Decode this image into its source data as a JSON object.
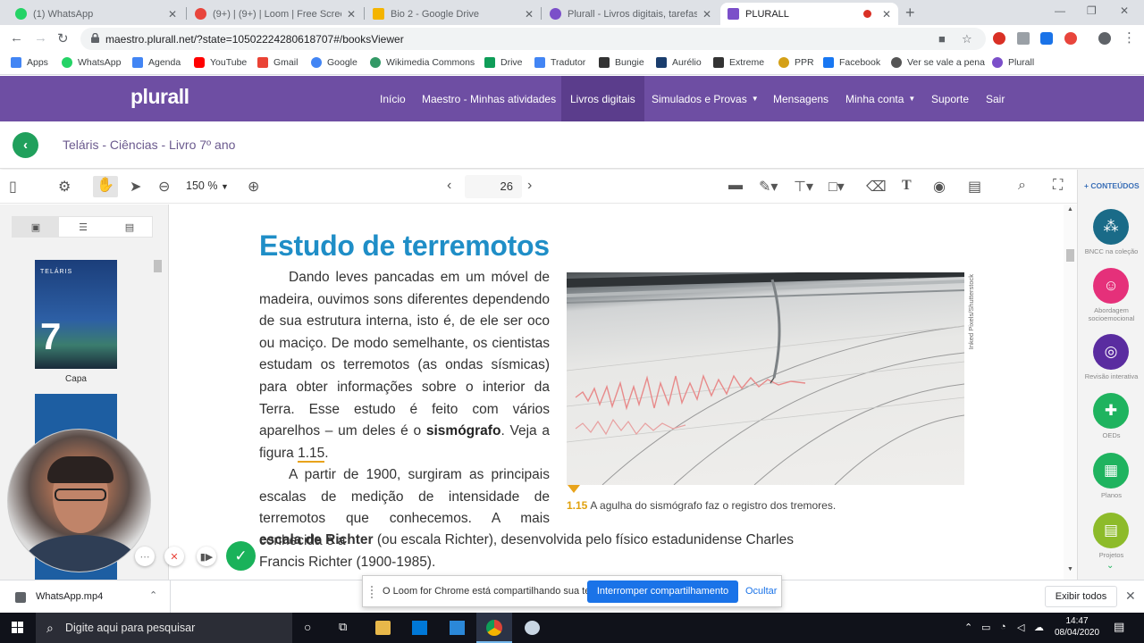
{
  "browser": {
    "tabs": [
      {
        "title": "(1) WhatsApp",
        "icon_color": "#25d366",
        "active": false
      },
      {
        "title": "(9+) | (9+) | Loom | Free Screen &",
        "icon_color": "#e8453c",
        "active": false
      },
      {
        "title": "Bio 2 - Google Drive",
        "icon_color": "#f4b400",
        "active": false
      },
      {
        "title": "Plurall - Livros digitais, tarefas, tu",
        "icon_color": "#7b4fc9",
        "active": false
      },
      {
        "title": "PLURALL",
        "icon_color": "#7b4fc9",
        "active": true
      }
    ],
    "url": "maestro.plurall.net/?state=10502224280618707#/booksViewer",
    "bookmarks": [
      {
        "label": "Apps",
        "icon_color": "#4285f4"
      },
      {
        "label": "WhatsApp",
        "icon_color": "#25d366"
      },
      {
        "label": "Agenda",
        "icon_color": "#4285f4"
      },
      {
        "label": "YouTube",
        "icon_color": "#ff0000"
      },
      {
        "label": "Gmail",
        "icon_color": "#ea4335"
      },
      {
        "label": "Google",
        "icon_color": "#4285f4"
      },
      {
        "label": "Wikimedia Commons",
        "icon_color": "#339966"
      },
      {
        "label": "Drive",
        "icon_color": "#0f9d58"
      },
      {
        "label": "Tradutor",
        "icon_color": "#4285f4"
      },
      {
        "label": "Bungie",
        "icon_color": "#333333"
      },
      {
        "label": "Aurélio",
        "icon_color": "#1a3d6d"
      },
      {
        "label": "Extreme",
        "icon_color": "#333333"
      },
      {
        "label": "PPR",
        "icon_color": "#d4a017"
      },
      {
        "label": "Facebook",
        "icon_color": "#1877f2"
      },
      {
        "label": "Ver se vale a pena",
        "icon_color": "#555555"
      },
      {
        "label": "Plurall",
        "icon_color": "#7b4fc9"
      }
    ]
  },
  "plurall": {
    "logo": "plurall",
    "nav": [
      {
        "label": "Início",
        "active": false
      },
      {
        "label": "Maestro - Minhas atividades",
        "active": false
      },
      {
        "label": "Livros digitais",
        "active": true
      },
      {
        "label": "Simulados e Provas",
        "active": false,
        "dropdown": true
      },
      {
        "label": "Mensagens",
        "active": false
      },
      {
        "label": "Minha conta",
        "active": false,
        "dropdown": true
      },
      {
        "label": "Suporte",
        "active": false
      },
      {
        "label": "Sair",
        "active": false
      }
    ],
    "book_title": "Teláris - Ciências - Livro 7º ano",
    "brand_color": "#6e4ea3"
  },
  "viewer": {
    "zoom": "150 %",
    "page": "26",
    "thumb_label": "Capa",
    "cover_number": "7",
    "cover_brand": "TELÁRIS",
    "sidebar_title": "+ CONTEÚDOS",
    "sidebar_items": [
      {
        "label": "BNCC na coleção",
        "color": "#1a6b88"
      },
      {
        "label": "Abordagem socioemocional",
        "color": "#e5307a"
      },
      {
        "label": "Revisão interativa",
        "color": "#5a2ca0"
      },
      {
        "label": "OEDs",
        "color": "#1fb35f"
      },
      {
        "label": "Planos",
        "color": "#1fb35f"
      },
      {
        "label": "Projetos",
        "color": "#8dbb2a"
      }
    ]
  },
  "content": {
    "heading": "Estudo de terremotos",
    "para1_indent": "Dando leves pancadas em um móvel de madeira, ouvimos sons diferentes dependendo de sua estrutura interna, isto é, de ele ser oco ou maciço. De modo semelhante, os cientistas estudam os terremotos (as ondas sísmicas) para obter informações sobre o interior da Terra. Esse estudo é feito com vários aparelhos – um deles é o ",
    "para1_bold": "sismógrafo",
    "para1_tail": ". Veja a figura ",
    "para1_ref": "1.15",
    "para1_end": ".",
    "para2": "A partir de 1900, surgiram as principais escalas de medição de intensidade de terremotos que conhecemos. A mais conhecida é a",
    "para3_bold": "escala de Richter",
    "para3_rest": " (ou escala Richter), desenvolvida pelo físico estadunidense Charles",
    "para4": "Francis Richter (1900-1985).",
    "photo_credit": "Inked Pixels/Shutterstock",
    "caption_num": "1.15",
    "caption_text": "A agulha do sismógrafo faz o registro dos tremores."
  },
  "downloads": {
    "file": "WhatsApp.mp4",
    "show_all": "Exibir todos"
  },
  "loom": {
    "message": "O Loom for Chrome está compartilhando sua tela.",
    "stop": "Interromper compartilhamento",
    "hide": "Ocultar"
  },
  "taskbar": {
    "search_placeholder": "Digite aqui para pesquisar",
    "time": "14:47",
    "date": "08/04/2020"
  }
}
